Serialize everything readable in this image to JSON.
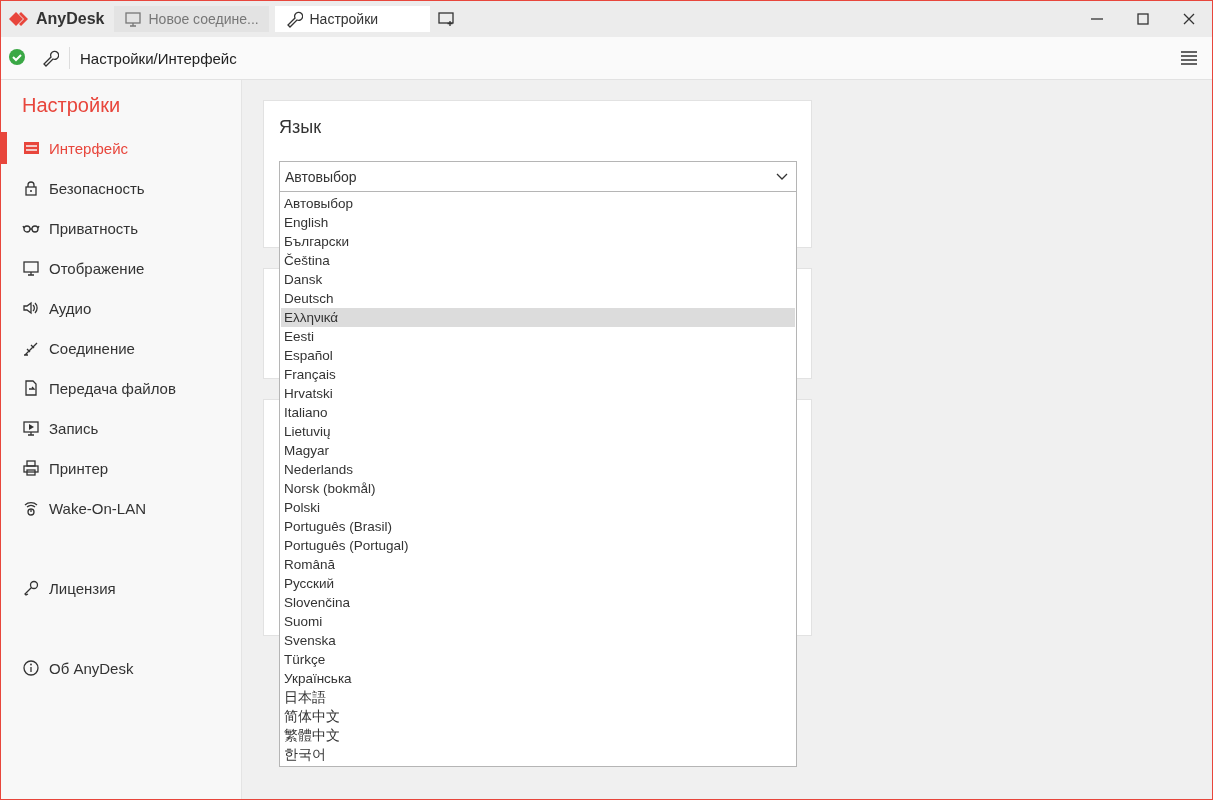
{
  "app": {
    "name": "AnyDesk"
  },
  "tabs": [
    {
      "label": "Новое соедине...",
      "kind": "monitor",
      "selected": false
    },
    {
      "label": "Настройки",
      "kind": "wrench",
      "selected": true
    }
  ],
  "toolbar": {
    "connected": true,
    "path": "Настройки/Интерфейс"
  },
  "sidebar": {
    "title": "Настройки",
    "items": [
      {
        "label": "Интерфейс",
        "kind": "interface",
        "selected": true
      },
      {
        "label": "Безопасность",
        "kind": "lock",
        "selected": false
      },
      {
        "label": "Приватность",
        "kind": "glasses",
        "selected": false
      },
      {
        "label": "Отображение",
        "kind": "monitor",
        "selected": false
      },
      {
        "label": "Аудио",
        "kind": "speaker",
        "selected": false
      },
      {
        "label": "Соединение",
        "kind": "network",
        "selected": false
      },
      {
        "label": "Передача файлов",
        "kind": "file",
        "selected": false
      },
      {
        "label": "Запись",
        "kind": "play",
        "selected": false
      },
      {
        "label": "Принтер",
        "kind": "printer",
        "selected": false
      },
      {
        "label": "Wake-On-LAN",
        "kind": "wol",
        "selected": false
      }
    ],
    "footer_items": [
      {
        "label": "Лицензия",
        "kind": "key",
        "selected": false
      },
      {
        "label": "Об AnyDesk",
        "kind": "info",
        "selected": false
      }
    ]
  },
  "language": {
    "title": "Язык",
    "value": "Автовыбор",
    "expanded": true,
    "options": [
      {
        "label": "Автовыбор",
        "highlighted": false
      },
      {
        "label": "English",
        "highlighted": false
      },
      {
        "label": "Български",
        "highlighted": false
      },
      {
        "label": "Čeština",
        "highlighted": false
      },
      {
        "label": "Dansk",
        "highlighted": false
      },
      {
        "label": "Deutsch",
        "highlighted": false
      },
      {
        "label": "Ελληνικά",
        "highlighted": true
      },
      {
        "label": "Eesti",
        "highlighted": false
      },
      {
        "label": "Español",
        "highlighted": false
      },
      {
        "label": "Français",
        "highlighted": false
      },
      {
        "label": "Hrvatski",
        "highlighted": false
      },
      {
        "label": "Italiano",
        "highlighted": false
      },
      {
        "label": "Lietuvių",
        "highlighted": false
      },
      {
        "label": "Magyar",
        "highlighted": false
      },
      {
        "label": "Nederlands",
        "highlighted": false
      },
      {
        "label": "Norsk (bokmål)",
        "highlighted": false
      },
      {
        "label": "Polski",
        "highlighted": false
      },
      {
        "label": "Português (Brasil)",
        "highlighted": false
      },
      {
        "label": "Português (Portugal)",
        "highlighted": false
      },
      {
        "label": "Română",
        "highlighted": false
      },
      {
        "label": "Русский",
        "highlighted": false
      },
      {
        "label": "Slovenčina",
        "highlighted": false
      },
      {
        "label": "Suomi",
        "highlighted": false
      },
      {
        "label": "Svenska",
        "highlighted": false
      },
      {
        "label": "Türkçe",
        "highlighted": false
      },
      {
        "label": "Українська",
        "highlighted": false
      },
      {
        "label": "日本語",
        "highlighted": false
      },
      {
        "label": "简体中文",
        "highlighted": false
      },
      {
        "label": "繁體中文",
        "highlighted": false
      },
      {
        "label": "한국어",
        "highlighted": false
      }
    ]
  }
}
